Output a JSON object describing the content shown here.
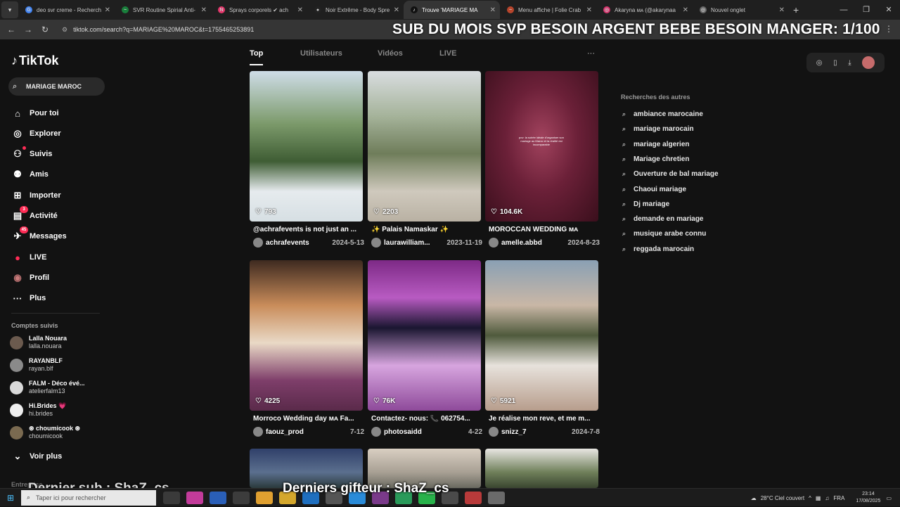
{
  "browser": {
    "tabs": [
      {
        "title": "deo svr creme - Recherch",
        "color": "#4285f4",
        "glyph": "G"
      },
      {
        "title": "SVR Routine Spirial Anti-",
        "color": "#1a7f3c",
        "glyph": "~"
      },
      {
        "title": "Sprays corporels ✔ ach",
        "color": "#e4356a",
        "glyph": "N"
      },
      {
        "title": "Noir Extrême - Body Spre",
        "color": "#222222",
        "glyph": "●"
      },
      {
        "title": "Trouve 'MARIAGE MA",
        "color": "#111111",
        "glyph": "♪"
      },
      {
        "title": "Menu affiche | Folie Crab",
        "color": "#b7452c",
        "glyph": "~"
      },
      {
        "title": "Akaryna ᴍᴀ (@akarynaa",
        "color": "#d6336c",
        "glyph": "◎"
      },
      {
        "title": "Nouvel onglet",
        "color": "#666666",
        "glyph": "◎"
      }
    ],
    "active_tab": 4,
    "url": "tiktok.com/search?q=MARIAGE%20MAROC&t=1755465253891",
    "stream_banner": "SUB DU MOIS SVP BESOIN ARGENT BEBE BESOIN MANGER: 1/100"
  },
  "tiktok": {
    "logo": "TikTok",
    "search_value": "MARIAGE MAROC",
    "nav": [
      {
        "label": "Pour toi",
        "icon": "home-icon"
      },
      {
        "label": "Explorer",
        "icon": "compass-icon"
      },
      {
        "label": "Suivis",
        "icon": "following-icon"
      },
      {
        "label": "Amis",
        "icon": "friends-icon"
      },
      {
        "label": "Importer",
        "icon": "upload-icon"
      },
      {
        "label": "Activité",
        "icon": "activity-icon",
        "badge": "3"
      },
      {
        "label": "Messages",
        "icon": "messages-icon",
        "badge": "45"
      },
      {
        "label": "LIVE",
        "icon": "live-icon"
      },
      {
        "label": "Profil",
        "icon": "profile-icon"
      },
      {
        "label": "Plus",
        "icon": "more-icon"
      }
    ],
    "followed_title": "Comptes suivis",
    "followed": [
      {
        "name": "Lalla Nouara",
        "handle": "lalla.nouara",
        "color": "#6b5a4e"
      },
      {
        "name": "RAYANBLF",
        "handle": "rayan.blf",
        "color": "#8a8a8a"
      },
      {
        "name": "FALM - Déco évé...",
        "handle": "atelierfalm13",
        "color": "#d9d9d9"
      },
      {
        "name": "Hi.Brides 💗",
        "handle": "hi.brides",
        "color": "#eeeeee"
      },
      {
        "name": "⊛ choumicook ⊛",
        "handle": "choumicook",
        "color": "#7a6a50"
      }
    ],
    "see_more": "Voir plus",
    "bottom_section": "Entreprise",
    "search_tabs": [
      "Top",
      "Utilisateurs",
      "Vidéos",
      "LIVE"
    ],
    "videos": [
      {
        "likes": "793",
        "caption": "@achrafevents is not just an ...",
        "user": "achrafevents",
        "date": "2024-5-13",
        "bg": "linear-gradient(180deg,#cfdde8 0%,#7c9a6b 35%,#3f5d34 60%,#e6ebee 80%,#d6dfe3 100%)"
      },
      {
        "likes": "2203",
        "caption": "✨ Palais Namaskar ✨",
        "user": "laurawilliam...",
        "date": "2023-11-19",
        "bg": "linear-gradient(180deg,#d9dde0 0%,#a5b39a 30%,#6f7d5a 55%,#cfc9bd 80%,#b9b1a3 100%)"
      },
      {
        "likes": "104.6K",
        "caption": "MOROCCAN WEDDING ᴍᴀ",
        "user": "amelle.abbd",
        "date": "2024-8-23",
        "bg": "radial-gradient(ellipse at 50% 45%,#a2435e 0%,#6b2038 45%,#3a0f1c 100%)",
        "overlay": "pov: la soirée idéale d'organiser son mariage au Maroc et la réalité est incomparable"
      },
      {
        "likes": "4225",
        "caption": "Morroco Wedding day ᴍᴀ Fa...",
        "user": "faouz_prod",
        "date": "7-12",
        "bg": "linear-gradient(180deg,#3e2a20 0%,#c98c5a 30%,#e9d9c6 55%,#7e3e6a 80%,#5a2a4a 100%)"
      },
      {
        "likes": "76K",
        "caption": "Contactez- nous: 📞 062754...",
        "user": "photosaidd",
        "date": "4-22",
        "bg": "linear-gradient(180deg,#7d2a86 0%,#b85bc2 25%,#1a1630 45%,#d7a5df 70%,#8e4a9a 100%)"
      },
      {
        "likes": "5921",
        "caption": "Je réalise mon reve, et me m...",
        "user": "snizz_7",
        "date": "2024-7-8",
        "bg": "linear-gradient(180deg,#8aa0b4 0%,#c9b7a6 30%,#4f5a3c 50%,#e7e2dc 70%,#b79d8c 100%)"
      },
      {
        "likes": "",
        "caption": "",
        "user": "",
        "date": "",
        "bg": "linear-gradient(180deg,#30406a 0%,#5b6f8e 60%,#2b3a3c 100%)"
      },
      {
        "likes": "",
        "caption": "",
        "user": "",
        "date": "",
        "bg": "linear-gradient(180deg,#d9cfc2 0%,#a8a094 60%,#6a6a60 100%)"
      },
      {
        "likes": "",
        "caption": "",
        "user": "",
        "date": "",
        "bg": "linear-gradient(180deg,#e8e6e2 0%,#6f7f5a 60%,#3a4630 100%)"
      }
    ],
    "others_title": "Recherches des autres",
    "suggestions": [
      "ambiance marocaine",
      "mariage marocain",
      "mariage algerien",
      "Mariage chretien",
      "Ouverture de bal mariage",
      "Chaoui mariage",
      "Dj mariage",
      "demande en mariage",
      "musique arabe connu",
      "reggada marocain"
    ]
  },
  "overlays": {
    "bottom_left": "Dernier sub : ShaZ_cs",
    "bottom_right": "Derniers gifteur : ShaZ_cs"
  },
  "taskbar": {
    "search_placeholder": "Taper ici pour rechercher",
    "weather": "28°C  Ciel couvert",
    "lang": "FRA",
    "time": "23:14",
    "date": "17/08/2025"
  }
}
